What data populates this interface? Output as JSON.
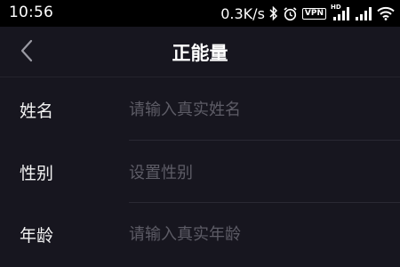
{
  "status_bar": {
    "time": "10:56",
    "network_speed": "0.3K/s",
    "icons": [
      "bluetooth-icon",
      "alarm-icon",
      "vpn-icon",
      "hd-signal-icon",
      "signal-icon",
      "wifi-icon"
    ],
    "vpn_label": "VPN",
    "hd_label": "HD"
  },
  "header": {
    "back_icon": "chevron-left-icon",
    "title": "正能量"
  },
  "form": {
    "fields": [
      {
        "label": "姓名",
        "placeholder": "请输入真实姓名",
        "type": "text"
      },
      {
        "label": "性别",
        "placeholder": "设置性别",
        "type": "select"
      },
      {
        "label": "年龄",
        "placeholder": "请输入真实年龄",
        "type": "text"
      }
    ]
  },
  "colors": {
    "background": "#17161f",
    "status_bar": "#000000",
    "text": "#ffffff",
    "placeholder": "#5d5c66",
    "divider": "#2a2933"
  }
}
